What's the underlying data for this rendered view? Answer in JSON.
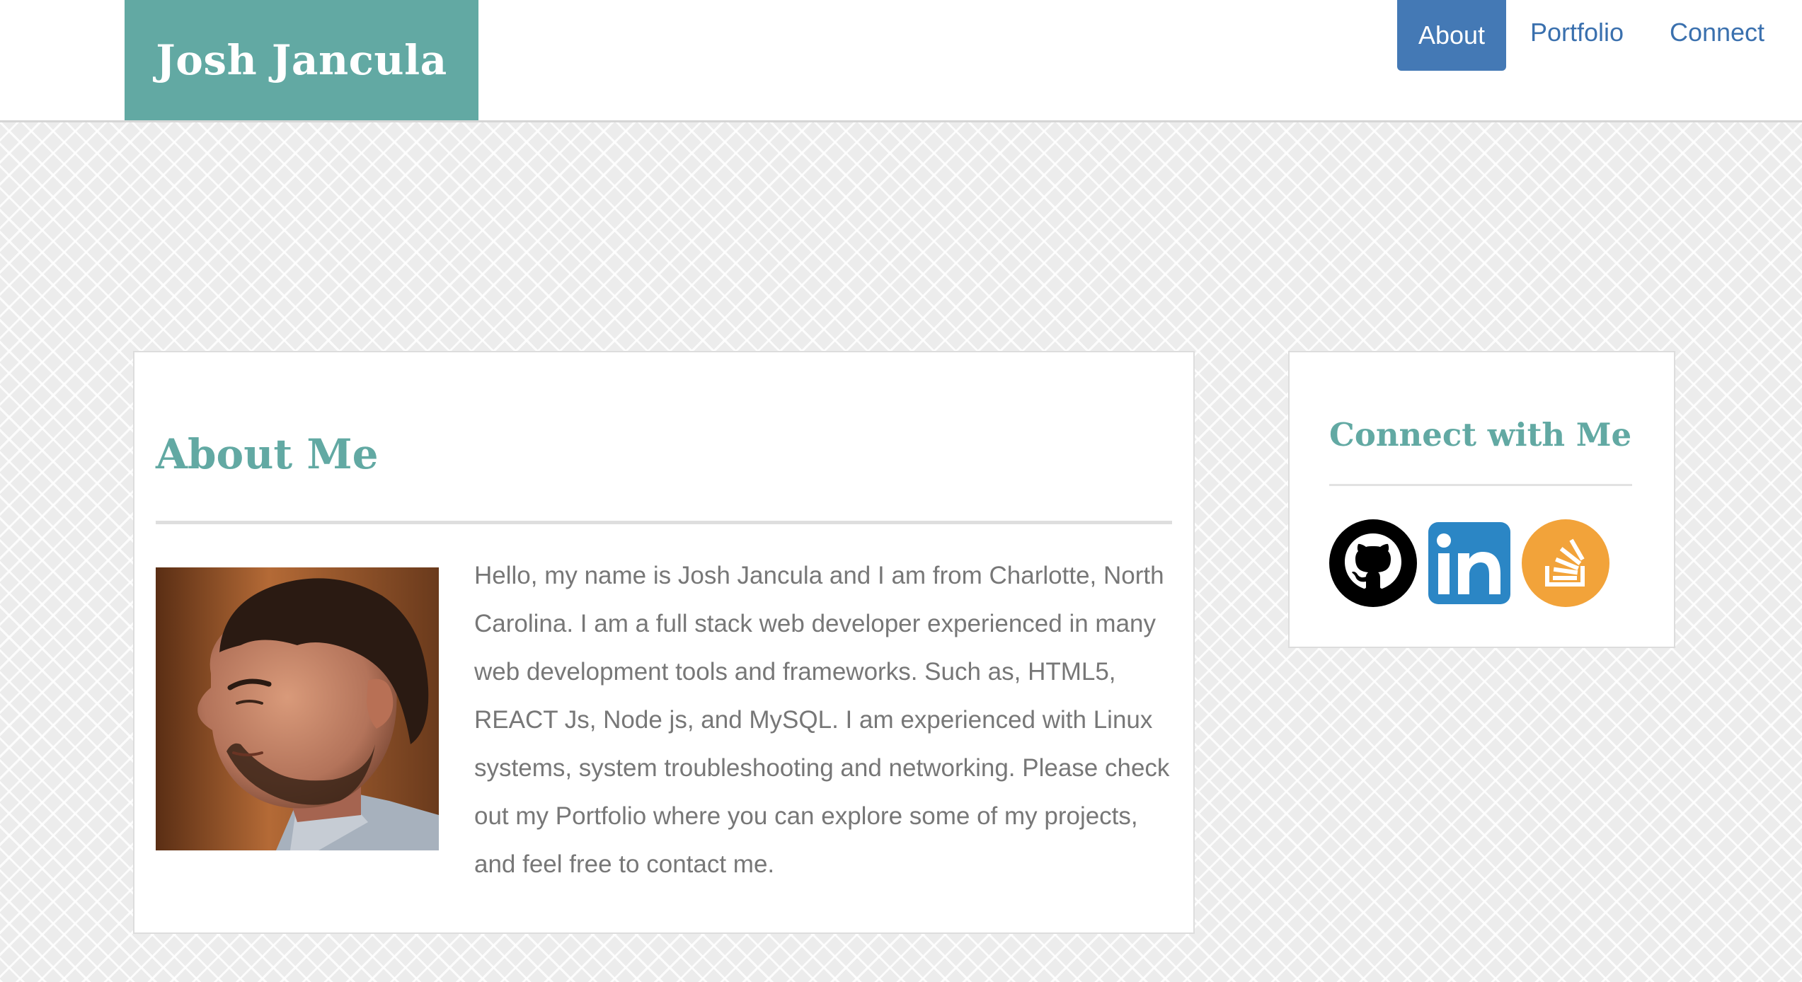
{
  "header": {
    "brand": "Josh Jancula",
    "nav": {
      "about": "About",
      "portfolio": "Portfolio",
      "connect": "Connect"
    },
    "active_nav": "about"
  },
  "about": {
    "title": "About Me",
    "photo_alt": "Portrait of Josh Jancula",
    "paragraph": "Hello, my name is Josh Jancula and I am from Charlotte, North Carolina. I am a full stack web developer experienced in many web development tools and frameworks. Such as, HTML5, REACT Js, Node js, and MySQL. I am experienced with Linux systems, system troubleshooting and networking. Please check out my Portfolio where you can explore some of my projects, and feel free to contact me."
  },
  "connect": {
    "title": "Connect with Me",
    "links": [
      {
        "icon": "github-icon",
        "label": "GitHub",
        "color": "#000000"
      },
      {
        "icon": "linkedin-icon",
        "label": "LinkedIn",
        "color": "#2b86c5"
      },
      {
        "icon": "stackoverflow-icon",
        "label": "Stack Overflow",
        "color": "#f2a33a"
      }
    ]
  },
  "colors": {
    "brand_bg": "#62a9a3",
    "nav_active_bg": "#4479b5",
    "nav_link": "#3a70ae",
    "heading": "#62a9a3",
    "body_text": "#777777"
  }
}
